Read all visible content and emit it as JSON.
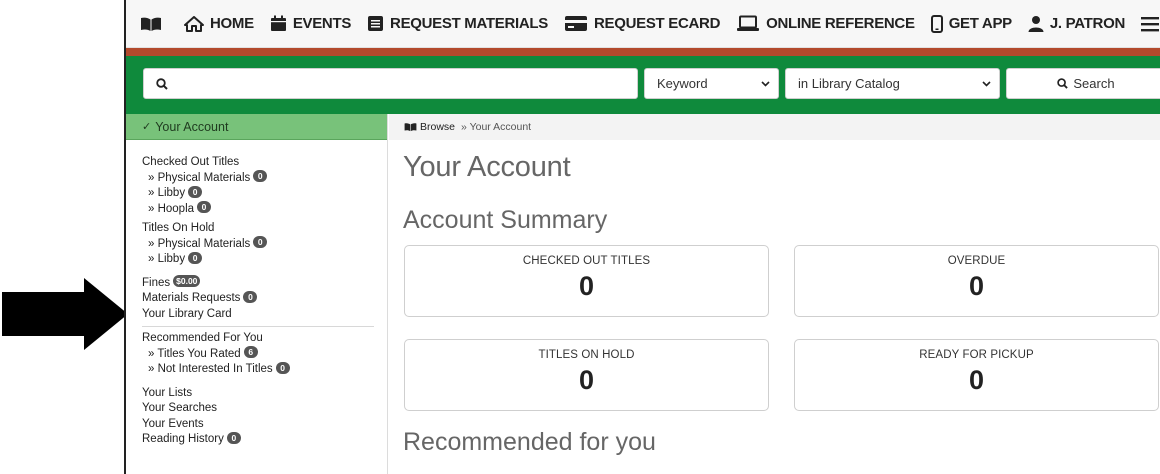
{
  "nav": {
    "home": "HOME",
    "events": "EVENTS",
    "request_materials": "REQUEST MATERIALS",
    "request_ecard": "REQUEST ECARD",
    "online_reference": "ONLINE REFERENCE",
    "get_app": "GET APP",
    "user": "J. PATRON"
  },
  "search": {
    "query": "",
    "type_selected": "Keyword",
    "scope_selected": "in Library Catalog",
    "button_label": "Search"
  },
  "sidebar": {
    "header": "Your Account",
    "checked_out": {
      "label": "Checked Out Titles",
      "items": [
        {
          "label": "» Physical Materials",
          "badge": "0"
        },
        {
          "label": "» Libby",
          "badge": "0"
        },
        {
          "label": "» Hoopla",
          "badge": "0"
        }
      ]
    },
    "on_hold": {
      "label": "Titles On Hold",
      "items": [
        {
          "label": "» Physical Materials",
          "badge": "0"
        },
        {
          "label": "» Libby",
          "badge": "0"
        }
      ]
    },
    "fines": {
      "label": "Fines",
      "badge": "$0.00"
    },
    "materials_requests": {
      "label": "Materials Requests",
      "badge": "0"
    },
    "library_card": "Your Library Card",
    "recommended": {
      "label": "Recommended For You",
      "items": [
        {
          "label": "» Titles You Rated",
          "badge": "6"
        },
        {
          "label": "» Not Interested In Titles",
          "badge": "0"
        }
      ]
    },
    "lists": "Your Lists",
    "searches": "Your Searches",
    "events": "Your Events",
    "reading_history": {
      "label": "Reading History",
      "badge": "0"
    }
  },
  "breadcrumb": {
    "home": "Browse",
    "current": "» Your Account"
  },
  "main": {
    "title": "Your Account",
    "summary_title": "Account Summary",
    "cards": {
      "checked_out": {
        "label": "CHECKED OUT TITLES",
        "value": "0"
      },
      "overdue": {
        "label": "OVERDUE",
        "value": "0"
      },
      "on_hold": {
        "label": "TITLES ON HOLD",
        "value": "0"
      },
      "pickup": {
        "label": "READY FOR PICKUP",
        "value": "0"
      }
    },
    "recommended_title": "Recommended for you"
  },
  "colors": {
    "green_band": "#0f8a3c",
    "sidebar_header": "#78c27a",
    "accent_stripe": "#b34a2c"
  }
}
